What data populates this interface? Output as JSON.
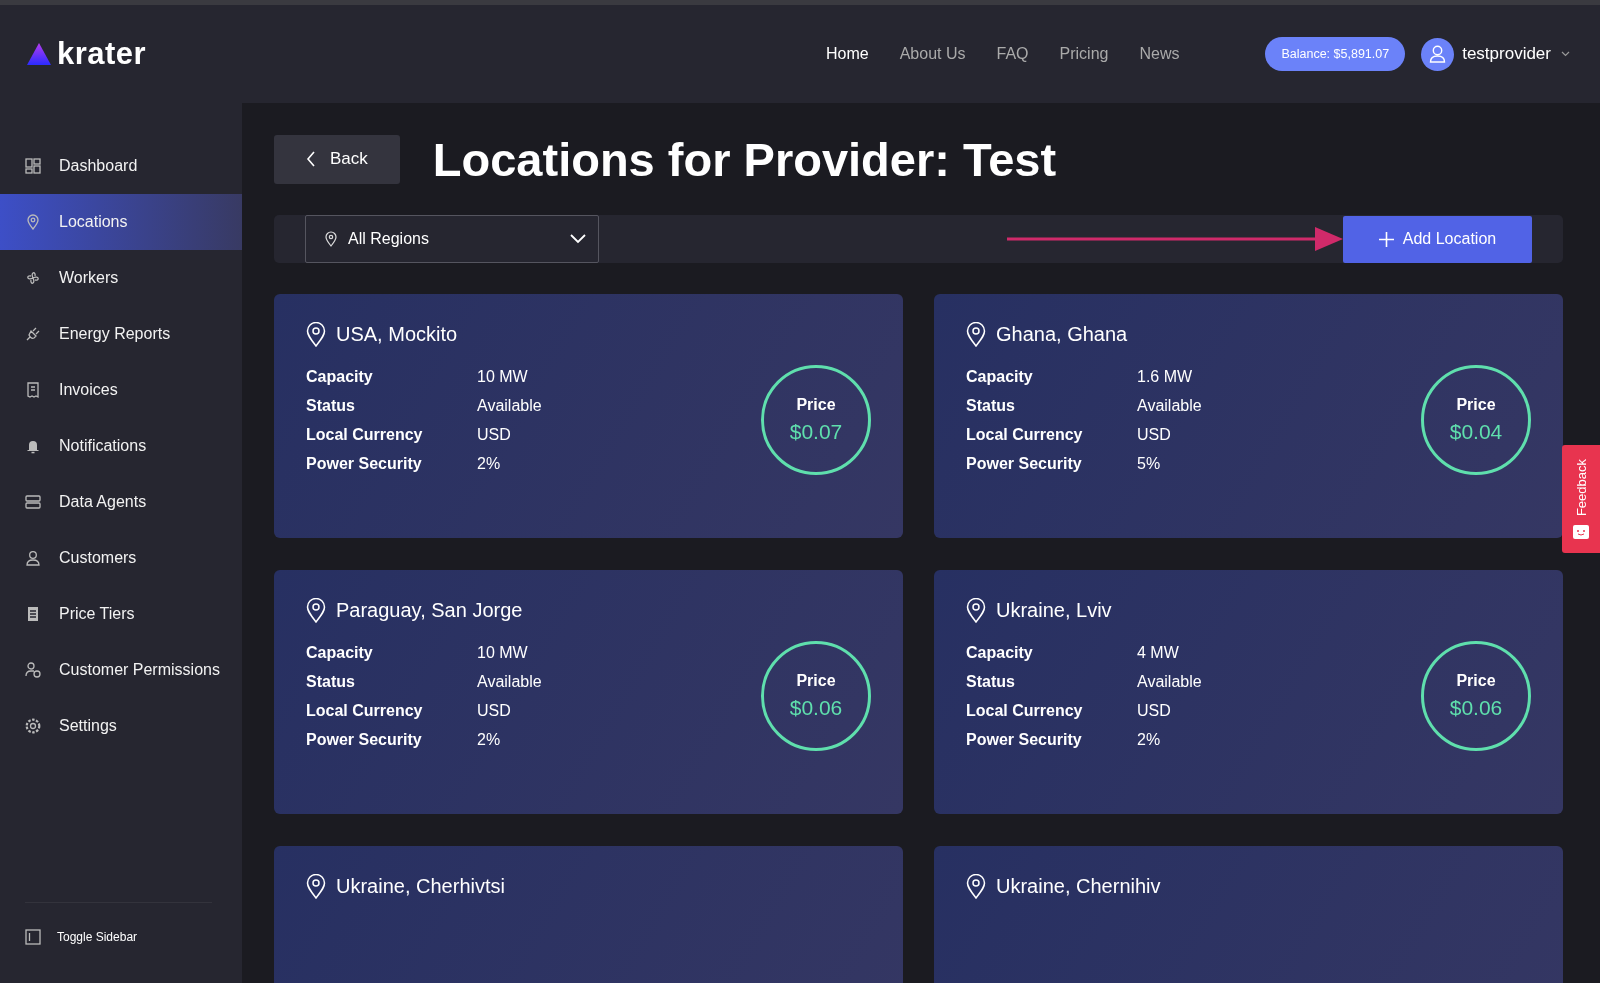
{
  "brand": {
    "name": "krater"
  },
  "nav": [
    {
      "label": "Home",
      "selected": true
    },
    {
      "label": "About Us",
      "selected": false
    },
    {
      "label": "FAQ",
      "selected": false
    },
    {
      "label": "Pricing",
      "selected": false
    },
    {
      "label": "News",
      "selected": false
    }
  ],
  "balance": "Balance: $5,891.07",
  "user": {
    "name": "testprovider"
  },
  "sidebar": {
    "items": [
      {
        "label": "Dashboard",
        "selected": false
      },
      {
        "label": "Locations",
        "selected": true
      },
      {
        "label": "Workers",
        "selected": false
      },
      {
        "label": "Energy Reports",
        "selected": false
      },
      {
        "label": "Invoices",
        "selected": false
      },
      {
        "label": "Notifications",
        "selected": false
      },
      {
        "label": "Data Agents",
        "selected": false
      },
      {
        "label": "Customers",
        "selected": false
      },
      {
        "label": "Price Tiers",
        "selected": false
      },
      {
        "label": "Customer Permissions",
        "selected": false
      },
      {
        "label": "Settings",
        "selected": false
      }
    ],
    "toggle": "Toggle Sidebar"
  },
  "back_button": "Back",
  "title": "Locations for Provider: Test",
  "region_filter": {
    "value": "All Regions"
  },
  "add_button": "Add Location",
  "locations": [
    {
      "name": "USA, Mockito",
      "fields": [
        {
          "label": "Capacity",
          "value": "10 MW"
        },
        {
          "label": "Status",
          "value": "Available"
        },
        {
          "label": "Local Currency",
          "value": "USD"
        },
        {
          "label": "Power Security",
          "value": "2%"
        }
      ],
      "price_label": "Price",
      "price": "$0.07"
    },
    {
      "name": "Ghana, Ghana",
      "fields": [
        {
          "label": "Capacity",
          "value": "1.6 MW"
        },
        {
          "label": "Status",
          "value": "Available"
        },
        {
          "label": "Local Currency",
          "value": "USD"
        },
        {
          "label": "Power Security",
          "value": "5%"
        }
      ],
      "price_label": "Price",
      "price": "$0.04"
    },
    {
      "name": "Paraguay, San Jorge",
      "fields": [
        {
          "label": "Capacity",
          "value": "10 MW"
        },
        {
          "label": "Status",
          "value": "Available"
        },
        {
          "label": "Local Currency",
          "value": "USD"
        },
        {
          "label": "Power Security",
          "value": "2%"
        }
      ],
      "price_label": "Price",
      "price": "$0.06"
    },
    {
      "name": "Ukraine, Lviv",
      "fields": [
        {
          "label": "Capacity",
          "value": "4 MW"
        },
        {
          "label": "Status",
          "value": "Available"
        },
        {
          "label": "Local Currency",
          "value": "USD"
        },
        {
          "label": "Power Security",
          "value": "2%"
        }
      ],
      "price_label": "Price",
      "price": "$0.06"
    },
    {
      "name": "Ukraine, Cherhivtsi"
    },
    {
      "name": "Ukraine, Chernihiv"
    }
  ],
  "feedback_tab": "Feedback"
}
